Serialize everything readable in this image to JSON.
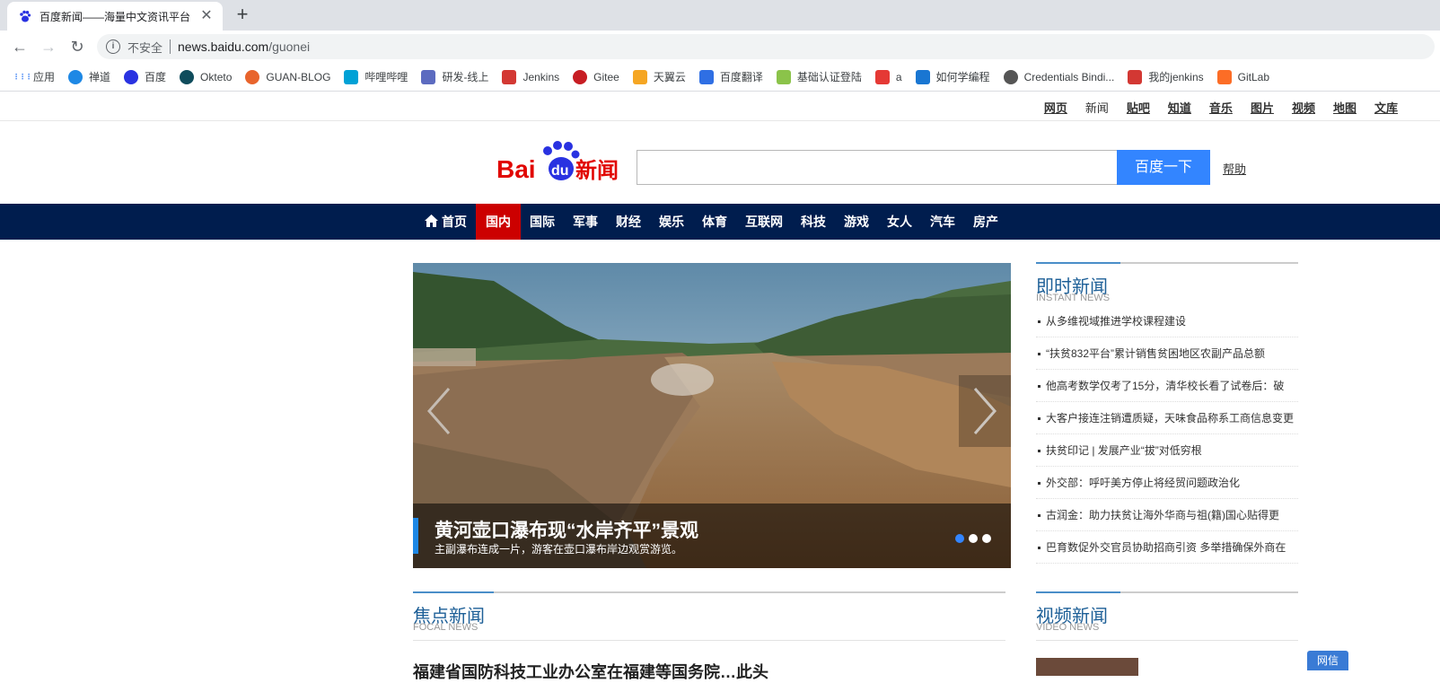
{
  "browser": {
    "tab_title": "百度新闻——海量中文资讯平台",
    "close_glyph": "✕",
    "newtab_glyph": "+",
    "back_glyph": "←",
    "forward_glyph": "→",
    "reload_glyph": "↻",
    "security_label": "不安全",
    "url_host": "news.baidu.com",
    "url_path": "/guonei",
    "bookmarks": [
      {
        "label": "应用",
        "icon": "apps-icon",
        "color": "#4285f4"
      },
      {
        "label": "禅道",
        "icon": "zentao-icon",
        "color": "#1e88e5"
      },
      {
        "label": "百度",
        "icon": "baidu-paw-icon",
        "color": "#2932e1"
      },
      {
        "label": "Okteto",
        "icon": "okteto-icon",
        "color": "#0f4c5c"
      },
      {
        "label": "GUAN-BLOG",
        "icon": "blog-icon",
        "color": "#e8642c"
      },
      {
        "label": "哔哩哔哩",
        "icon": "bilibili-icon",
        "color": "#00a1d6"
      },
      {
        "label": "研发-线上",
        "icon": "dev-icon",
        "color": "#5c6bc0"
      },
      {
        "label": "Jenkins",
        "icon": "jenkins-icon",
        "color": "#d33833"
      },
      {
        "label": "Gitee",
        "icon": "gitee-icon",
        "color": "#c71d23"
      },
      {
        "label": "天翼云",
        "icon": "cloud-icon",
        "color": "#f5a623"
      },
      {
        "label": "百度翻译",
        "icon": "translate-icon",
        "color": "#2f6fe4"
      },
      {
        "label": "基础认证登陆",
        "icon": "leaf-icon",
        "color": "#8bc34a"
      },
      {
        "label": "a",
        "icon": "sc-icon",
        "color": "#e53935"
      },
      {
        "label": "如何学编程",
        "icon": "code-icon",
        "color": "#1976d2"
      },
      {
        "label": "Credentials Bindi...",
        "icon": "globe-icon",
        "color": "#555555"
      },
      {
        "label": "我的jenkins",
        "icon": "jenkins-icon",
        "color": "#d33833"
      },
      {
        "label": "GitLab",
        "icon": "gitlab-icon",
        "color": "#fc6d26"
      }
    ]
  },
  "topnav": {
    "links": [
      "网页",
      "新闻",
      "贴吧",
      "知道",
      "音乐",
      "图片",
      "视频",
      "地图",
      "文库"
    ],
    "current": "新闻"
  },
  "search": {
    "logo_prefix": "Bai",
    "logo_du": "du",
    "logo_suffix": "新闻",
    "input_value": "",
    "button_label": "百度一下",
    "help_label": "帮助"
  },
  "channels": {
    "items": [
      "首页",
      "国内",
      "国际",
      "军事",
      "财经",
      "娱乐",
      "体育",
      "互联网",
      "科技",
      "游戏",
      "女人",
      "汽车",
      "房产"
    ],
    "active": "国内"
  },
  "slider": {
    "title": "黄河壶口瀑布现“水岸齐平”景观",
    "subtitle": "主副瀑布连成一片，游客在壶口瀑布岸边观赏游览。",
    "dot_count": 3,
    "active_dot": 0
  },
  "instant_news": {
    "title": "即时新闻",
    "title_en": "INSTANT NEWS",
    "items": [
      "从多维视域推进学校课程建设",
      "“扶贫832平台”累计销售贫困地区农副产品总额",
      "他高考数学仅考了15分，清华校长看了试卷后：破",
      "大客户接连注销遭质疑，天味食品称系工商信息变更",
      "扶贫印记 | 发展产业“拔”对低穷根",
      "外交部：呼吁美方停止将经贸问题政治化",
      "古润金：助力扶贫让海外华商与祖(籍)国心贴得更",
      "巴育数促外交官员协助招商引资 多举措确保外商在"
    ]
  },
  "focal_news": {
    "title": "焦点新闻",
    "title_en": "FOCAL NEWS",
    "headline": "福建省国防科技工业办公室在福建等国务院…此头"
  },
  "video_news": {
    "title": "视频新闻",
    "title_en": "VIDEO NEWS"
  },
  "feedback": {
    "label": "网信"
  }
}
